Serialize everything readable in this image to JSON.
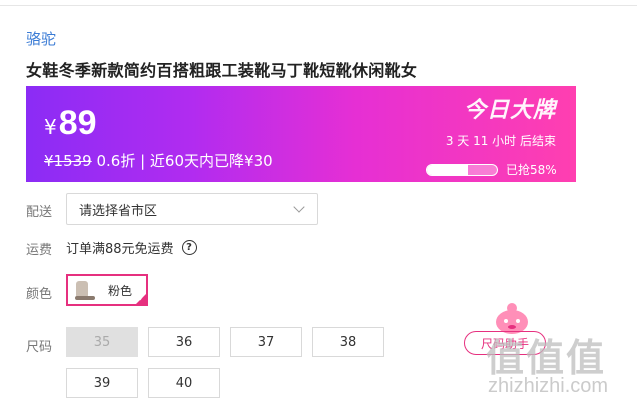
{
  "product": {
    "brand": "骆驼",
    "title": "女鞋冬季新款简约百搭粗跟工装靴马丁靴短靴休闲靴女"
  },
  "banner": {
    "currency": "¥",
    "price": "89",
    "original_price": "¥1539",
    "details": " 0.6折 | 近60天内已降¥30",
    "badge": "今日大牌",
    "countdown": "3 天 11 小时 后结束",
    "progress_percent": 58,
    "progress_text": "已抢58%"
  },
  "delivery": {
    "label": "配送",
    "select_value": "请选择省市区"
  },
  "shipping": {
    "label": "运费",
    "text": "订单满88元免运费",
    "help_icon": "?"
  },
  "color": {
    "label": "颜色",
    "option": "粉色"
  },
  "size": {
    "label": "尺码",
    "options": [
      "35",
      "36",
      "37",
      "38",
      "39",
      "40"
    ],
    "size_chart_button": "尺码助手"
  },
  "watermark": {
    "text": "值值值",
    "url": "zhizhizhi.com"
  },
  "colors": {
    "accent": "#e6307f",
    "brand_link": "#3a7bd5",
    "banner_start": "#8b2cf5",
    "banner_end": "#ff3fb0"
  }
}
